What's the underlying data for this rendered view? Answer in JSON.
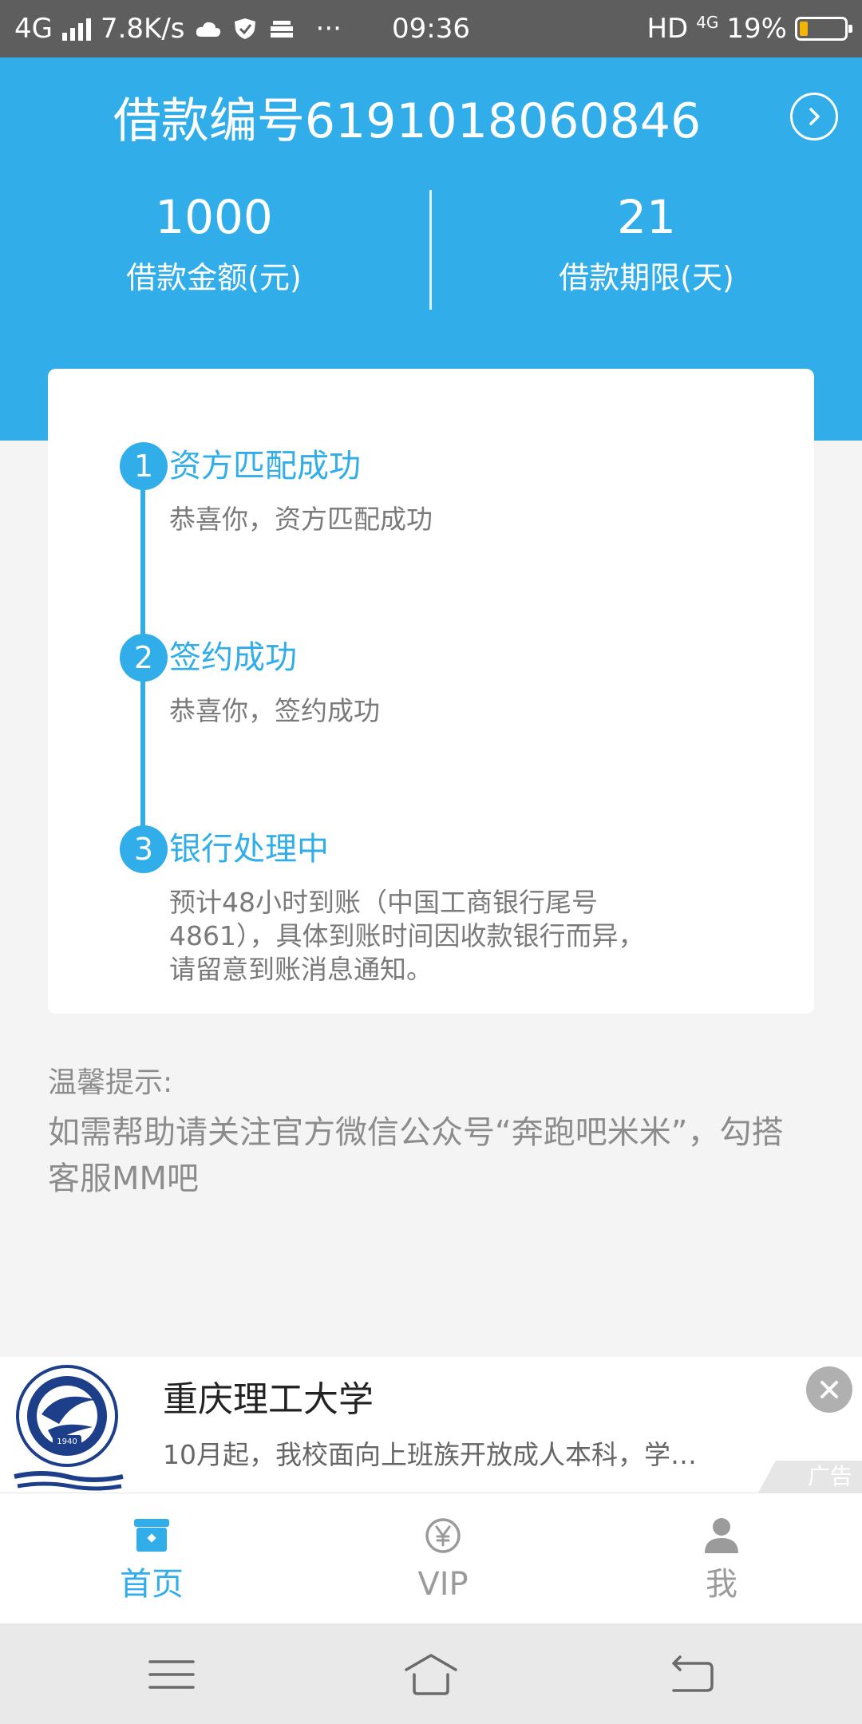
{
  "status_bar": {
    "network": "4G",
    "speed": "7.8K/s",
    "more": "···",
    "time": "09:36",
    "hd": "HD",
    "network_small": "4G",
    "battery": "19%",
    "battery_level": 0.19
  },
  "header": {
    "loan_title": "借款编号6191018060846",
    "amount_value": "1000",
    "amount_label": "借款金额(元)",
    "term_value": "21",
    "term_label": "借款期限(天)"
  },
  "steps": [
    {
      "num": "1",
      "title": "资方匹配成功",
      "desc": "恭喜你，资方匹配成功"
    },
    {
      "num": "2",
      "title": "签约成功",
      "desc": "恭喜你，签约成功"
    },
    {
      "num": "3",
      "title": "银行处理中",
      "desc": "预计48小时到账（中国工商银行尾号4861），具体到账时间因收款银行而异，请留意到账消息通知。"
    }
  ],
  "tips": {
    "title": "温馨提示:",
    "body": "如需帮助请关注官方微信公众号“奔跑吧米米”，勾搭客服MM吧"
  },
  "ad": {
    "title": "重庆理工大学",
    "desc": "10月起，我校面向上班族开放成人本科，学…",
    "badge": "广告",
    "logo_year": "1940"
  },
  "tabs": [
    {
      "label": "首页",
      "icon": "home-store-icon",
      "active": true
    },
    {
      "label": "VIP",
      "icon": "yen-coin-icon",
      "active": false
    },
    {
      "label": "我",
      "icon": "user-icon",
      "active": false
    }
  ],
  "colors": {
    "accent": "#31aee9",
    "status_bar": "#5e5e5e",
    "background": "#f4f4f4"
  }
}
